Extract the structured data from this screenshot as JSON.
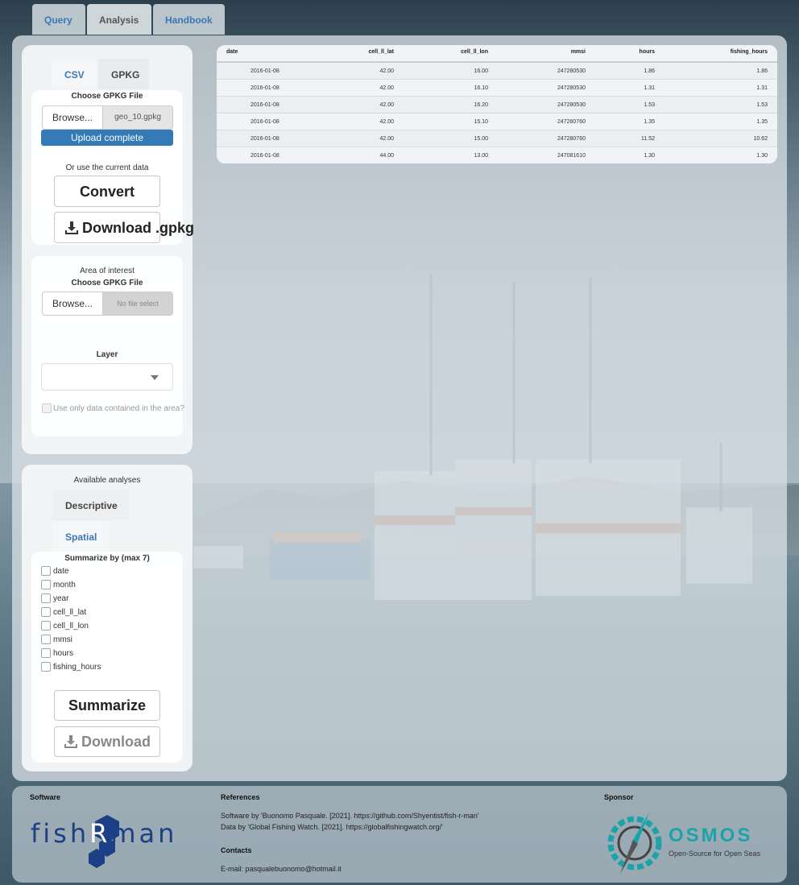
{
  "nav": {
    "tabs": [
      {
        "label": "Query"
      },
      {
        "label": "Analysis"
      },
      {
        "label": "Handbook"
      }
    ]
  },
  "import_panel": {
    "tabs": [
      {
        "label": "CSV"
      },
      {
        "label": "GPKG"
      }
    ],
    "choose_label": "Choose GPKG File",
    "browse_label": "Browse...",
    "file_name": "geo_10.gpkg",
    "upload_status": "Upload complete",
    "or_use_label": "Or use the current data",
    "convert_label": "Convert",
    "download_label": "Download .gpkg"
  },
  "area_panel": {
    "title": "Area of interest",
    "choose_label": "Choose GPKG File",
    "browse_label": "Browse...",
    "file_placeholder": "No file select",
    "layer_label": "Layer",
    "layer_value": "",
    "checkbox_label": "Use only data contained in the area?"
  },
  "analyses_panel": {
    "title": "Available analyses",
    "tabs": [
      {
        "label": "Descriptive"
      },
      {
        "label": "Spatial"
      }
    ],
    "summarize_by_label": "Summarize by (max 7)",
    "fields": [
      "date",
      "month",
      "year",
      "cell_ll_lat",
      "cell_ll_lon",
      "mmsi",
      "hours",
      "fishing_hours"
    ],
    "summarize_label": "Summarize",
    "download_label": "Download"
  },
  "table": {
    "columns": [
      "date",
      "cell_ll_lat",
      "cell_ll_lon",
      "mmsi",
      "hours",
      "fishing_hours"
    ],
    "rows": [
      [
        "2016-01-08",
        "42.00",
        "16.00",
        "247280530",
        "1.86",
        "1.86"
      ],
      [
        "2016-01-08",
        "42.00",
        "16.10",
        "247280530",
        "1.31",
        "1.31"
      ],
      [
        "2016-01-08",
        "42.00",
        "16.20",
        "247280530",
        "1.53",
        "1.53"
      ],
      [
        "2016-01-08",
        "42.00",
        "15.10",
        "247280760",
        "1.35",
        "1.35"
      ],
      [
        "2016-01-08",
        "42.00",
        "15.00",
        "247280760",
        "11.52",
        "10.62"
      ],
      [
        "2016-01-08",
        "44.00",
        "13.00",
        "247081610",
        "1.30",
        "1.30"
      ]
    ]
  },
  "footer": {
    "software_heading": "Software",
    "software_logo_text": "fishRman",
    "references_heading": "References",
    "ref_software": "Software by 'Buonomo Pasquale. [2021]. https://github.com/Shyentist/fish-r-man'",
    "ref_data": "Data by 'Global Fishing Watch. [2021]. https://globalfishingwatch.org/'",
    "contacts_heading": "Contacts",
    "contact_email": "E-mail: pasqualebuonomo@hotmail.it",
    "sponsor_heading": "Sponsor",
    "sponsor_name": "OSMOS",
    "sponsor_tagline": "Open-Source for Open Seas"
  },
  "colors": {
    "accent": "#337ab7",
    "panel": "#d6dee3",
    "osmos_teal": "#1aa3a8"
  }
}
